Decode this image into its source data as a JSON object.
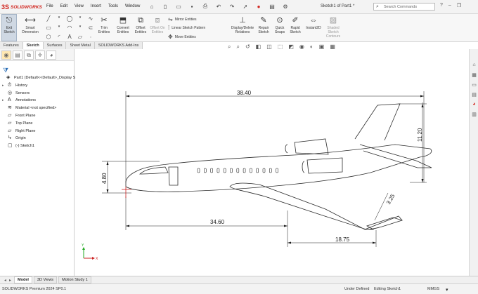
{
  "app": {
    "logo_mark": "3S",
    "logo_text": "SOLIDWORKS",
    "document_title": "Sketch1 of Part1 *"
  },
  "menu": [
    "File",
    "Edit",
    "View",
    "Insert",
    "Tools",
    "Window"
  ],
  "search": {
    "placeholder": "Search Commands"
  },
  "commands": {
    "exit_sketch": "Exit Sketch",
    "smart_dimension": "Smart Dimension",
    "trim": "Trim Entities",
    "convert": "Convert Entities",
    "offset": "Offset Entities",
    "offset_on_surface": "Offset On Entities",
    "mirror": "Mirror Entities",
    "linear_pattern": "Linear Sketch Pattern",
    "move": "Move Entities",
    "display_delete": "Display/Delete Relations",
    "repair": "Repair Sketch",
    "quick_snaps": "Quick Snaps",
    "rapid_sketch": "Rapid Sketch",
    "instant2d": "Instant2D",
    "shaded_contours": "Shaded Sketch Contours"
  },
  "ribbon_tabs": [
    {
      "label": "Features",
      "active": false
    },
    {
      "label": "Sketch",
      "active": true
    },
    {
      "label": "Surfaces",
      "active": false
    },
    {
      "label": "Sheet Metal",
      "active": false
    },
    {
      "label": "SOLIDWORKS Add-Ins",
      "active": false
    }
  ],
  "feature_tree": [
    {
      "label": "Part1  (Default<<Default>_Display Sta",
      "icon": "part-icon",
      "expand": "",
      "indent": 0
    },
    {
      "label": "History",
      "icon": "history-icon",
      "expand": "▸",
      "indent": 1
    },
    {
      "label": "Sensors",
      "icon": "sensors-icon",
      "expand": "",
      "indent": 1
    },
    {
      "label": "Annotations",
      "icon": "annotations-icon",
      "expand": "▸",
      "indent": 1
    },
    {
      "label": "Material <not specified>",
      "icon": "material-icon",
      "expand": "",
      "indent": 1
    },
    {
      "label": "Front Plane",
      "icon": "plane-icon",
      "expand": "",
      "indent": 1
    },
    {
      "label": "Top Plane",
      "icon": "plane-icon",
      "expand": "",
      "indent": 1
    },
    {
      "label": "Right Plane",
      "icon": "plane-icon",
      "expand": "",
      "indent": 1
    },
    {
      "label": "Origin",
      "icon": "origin-icon",
      "expand": "",
      "indent": 1
    },
    {
      "label": "(-) Sketch1",
      "icon": "sketch-icon",
      "expand": "",
      "indent": 1
    }
  ],
  "dimensions": {
    "overall_length": "38.40",
    "tail_height": "11.20",
    "fuselage_height": "4.80",
    "nose_to_wing": "34.60",
    "wing_chord": "18.75",
    "wingtip": "3.25"
  },
  "bottom_tabs": [
    {
      "label": "Model",
      "active": true
    },
    {
      "label": "3D Views",
      "active": false
    },
    {
      "label": "Motion Study 1",
      "active": false
    }
  ],
  "status": {
    "version": "SOLIDWORKS Premium 2024 SP0.1",
    "definition": "Under Defined",
    "editing": "Editing Sketch1",
    "units": "MMGS"
  },
  "colors": {
    "accent": "#d1261f",
    "dimension": "#1a1a1a",
    "sketch_line": "#2b2b2b",
    "triad_x": "#cc2222",
    "triad_y": "#22aa22"
  }
}
